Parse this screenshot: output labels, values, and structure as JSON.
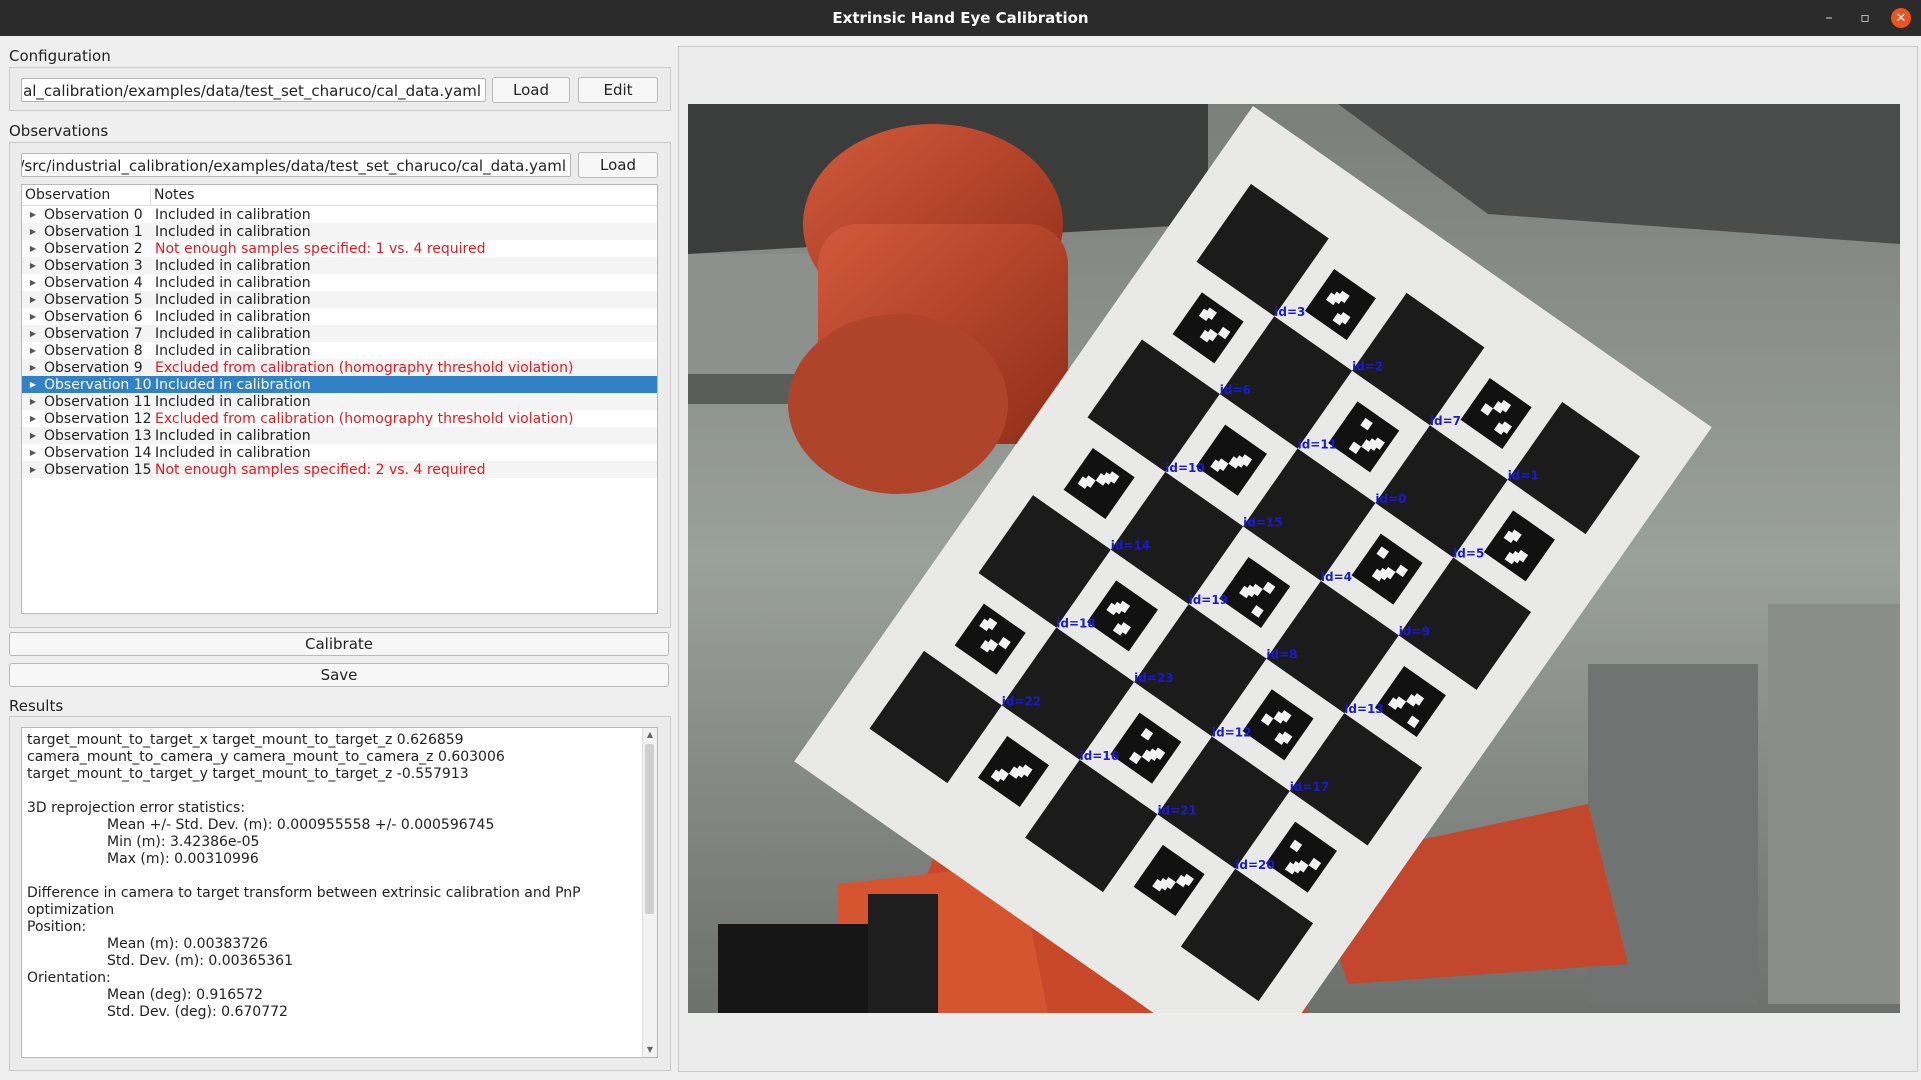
{
  "window": {
    "title": "Extrinsic Hand Eye Calibration"
  },
  "configuration": {
    "label": "Configuration",
    "path": "dustrial_calibration/examples/data/test_set_charuco/cal_data.yaml",
    "load_label": "Load",
    "edit_label": "Edit"
  },
  "observations": {
    "label": "Observations",
    "path": "abr_ws/src/industrial_calibration/examples/data/test_set_charuco/cal_data.yaml",
    "load_label": "Load",
    "columns": [
      "Observation",
      "Notes"
    ],
    "rows": [
      {
        "name": "Observation 0",
        "note": "Included in calibration"
      },
      {
        "name": "Observation 1",
        "note": "Included in calibration"
      },
      {
        "name": "Observation 2",
        "note": "Not enough samples specified: 1 vs. 4 required"
      },
      {
        "name": "Observation 3",
        "note": "Included in calibration"
      },
      {
        "name": "Observation 4",
        "note": "Included in calibration"
      },
      {
        "name": "Observation 5",
        "note": "Included in calibration"
      },
      {
        "name": "Observation 6",
        "note": "Included in calibration"
      },
      {
        "name": "Observation 7",
        "note": "Included in calibration"
      },
      {
        "name": "Observation 8",
        "note": "Included in calibration"
      },
      {
        "name": "Observation 9",
        "note": "Excluded from calibration (homography threshold violation)"
      },
      {
        "name": "Observation 10",
        "note": "Included in calibration"
      },
      {
        "name": "Observation 11",
        "note": "Included in calibration"
      },
      {
        "name": "Observation 12",
        "note": "Excluded from calibration (homography threshold violation)"
      },
      {
        "name": "Observation 13",
        "note": "Included in calibration"
      },
      {
        "name": "Observation 14",
        "note": "Included in calibration"
      },
      {
        "name": "Observation 15",
        "note": "Not enough samples specified: 2 vs. 4 required"
      }
    ],
    "selected_row": "Observation 10"
  },
  "actions": {
    "calibrate_label": "Calibrate",
    "save_label": "Save"
  },
  "results": {
    "label": "Results",
    "lines": [
      "target_mount_to_target_x target_mount_to_target_z 0.626859",
      "camera_mount_to_camera_y camera_mount_to_camera_z 0.603006",
      "target_mount_to_target_y target_mount_to_target_z -0.557913",
      "",
      "3D reprojection error statistics:",
      "Mean +/- Std. Dev. (m): 0.000955558 +/- 0.000596745",
      "Min (m): 3.42386e-05",
      "Max (m): 0.00310996",
      "",
      "Difference in camera to target transform between extrinsic calibration and PnP optimization",
      "Position:",
      "Mean (m): 0.00383726",
      "Std. Dev. (m): 0.00365361",
      "Orientation:",
      "Mean (deg): 0.916572",
      "Std. Dev. (deg): 0.670772"
    ]
  },
  "marker_ids": [
    "id=3",
    "id=2",
    "id=7",
    "id=1",
    "id=6",
    "id=11",
    "id=0",
    "id=5",
    "id=10",
    "id=15",
    "id=4",
    "id=9",
    "id=14",
    "id=19",
    "id=8",
    "id=13",
    "id=18",
    "id=23",
    "id=12",
    "id=17",
    "id=22",
    "id=16",
    "id=21",
    "id=20"
  ],
  "colors": {
    "selection": "#3081c5",
    "error_text": "#e8161d",
    "marker_label": "#1a1ad6",
    "robot": "#c8492a"
  }
}
